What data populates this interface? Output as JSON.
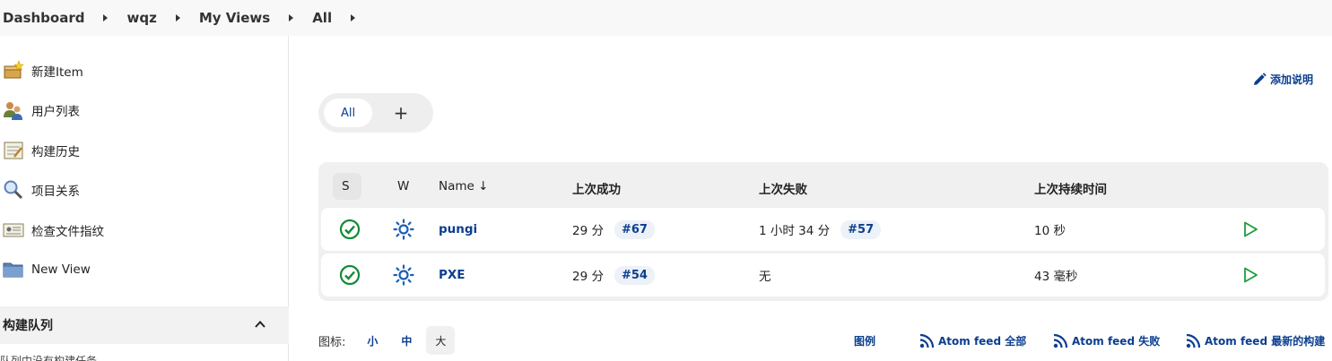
{
  "breadcrumb": {
    "items": [
      "Dashboard",
      "wqz",
      "My Views",
      "All"
    ]
  },
  "sidebar": {
    "items": [
      {
        "label": "新建Item",
        "icon": "new-item-icon"
      },
      {
        "label": "用户列表",
        "icon": "users-icon"
      },
      {
        "label": "构建历史",
        "icon": "build-history-icon"
      },
      {
        "label": "项目关系",
        "icon": "search-icon"
      },
      {
        "label": "检查文件指纹",
        "icon": "fingerprint-icon"
      },
      {
        "label": "New View",
        "icon": "folder-icon"
      }
    ],
    "queue": {
      "title": "构建队列",
      "empty_text": "队列中没有构建任务"
    }
  },
  "main": {
    "add_description": "添加说明",
    "tabs": {
      "active": "All",
      "add": "+"
    },
    "table": {
      "headers": {
        "s": "S",
        "w": "W",
        "name": "Name ↓",
        "last_success": "上次成功",
        "last_failure": "上次失败",
        "last_duration": "上次持续时间"
      },
      "rows": [
        {
          "name": "pungi",
          "last_success": "29 分",
          "success_build": "#67",
          "last_failure": "1 小时 34 分",
          "failure_build": "#57",
          "duration": "10 秒"
        },
        {
          "name": "PXE",
          "last_success": "29 分",
          "success_build": "#54",
          "last_failure": "无",
          "failure_build": "",
          "duration": "43 毫秒"
        }
      ]
    },
    "icon_size": {
      "label": "图标:",
      "options": [
        "小",
        "中",
        "大"
      ],
      "selected": "大"
    },
    "footer_links": {
      "legend": "图例",
      "atom_all": "Atom feed 全部",
      "atom_failed": "Atom feed 失败",
      "atom_latest": "Atom feed 最新的构建"
    }
  },
  "colors": {
    "link": "#0b3e8f",
    "success": "#138a36",
    "weather": "#1a5fb4",
    "run": "#1e9e3e"
  }
}
